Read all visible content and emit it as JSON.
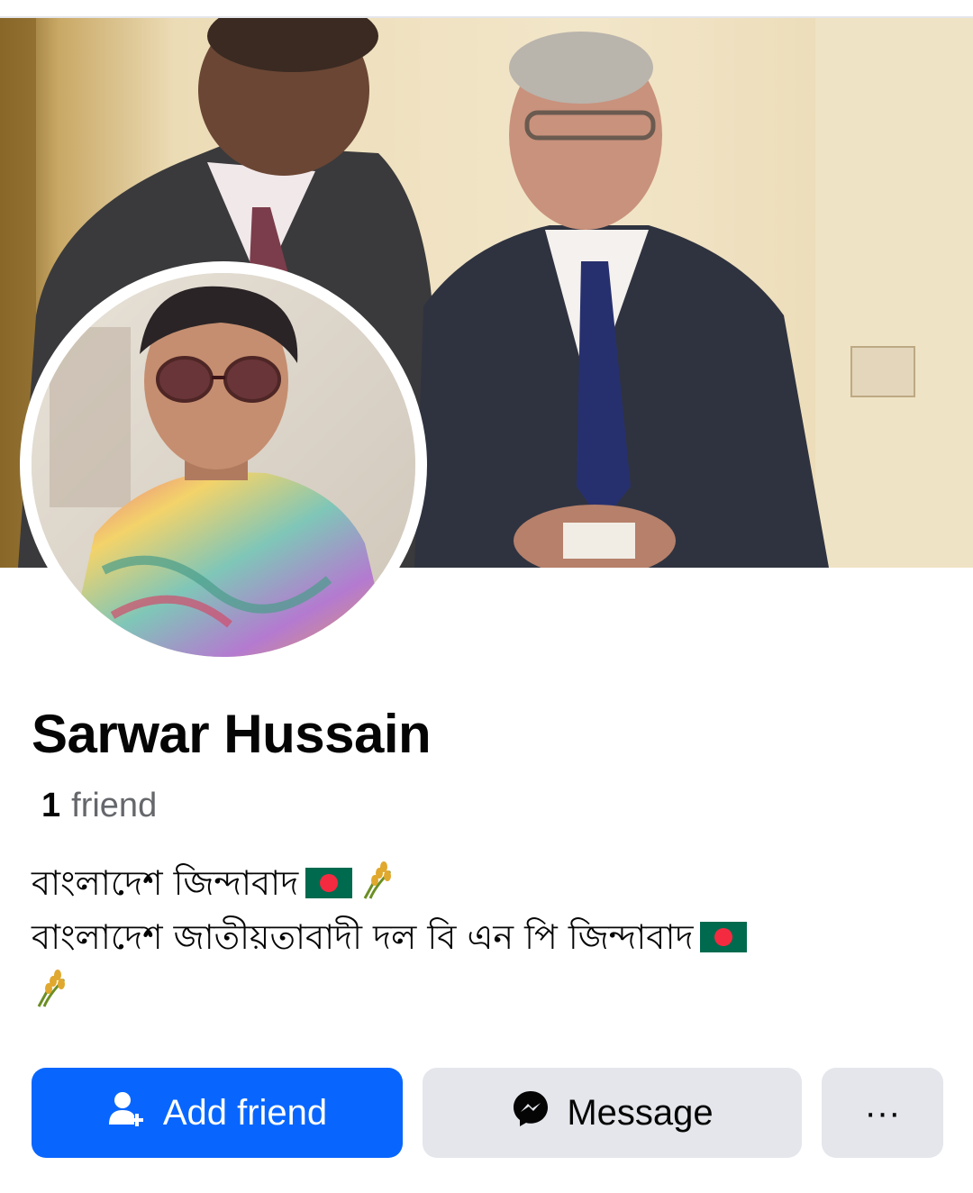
{
  "profile": {
    "name": "Sarwar Hussain",
    "friend_count": "1",
    "friend_label": "friend",
    "bio_line_1": "বাংলাদেশ জিন্দাবাদ",
    "bio_line_2": "বাংলাদেশ জাতীয়তাবাদী দল বি এন পি জিন্দাবাদ"
  },
  "actions": {
    "add_friend_label": "Add friend",
    "message_label": "Message",
    "more_label": "···"
  },
  "icons": {
    "add_friend": "person-plus-icon",
    "message": "messenger-icon",
    "bio_flag": "bangladesh-flag-icon",
    "bio_rice": "rice-sheaf-icon"
  },
  "colors": {
    "primary": "#0866ff",
    "secondary_button": "#e4e6eb",
    "text": "#050505",
    "muted": "#65676b",
    "flag_green": "#006a4e",
    "flag_red": "#f42a41"
  }
}
